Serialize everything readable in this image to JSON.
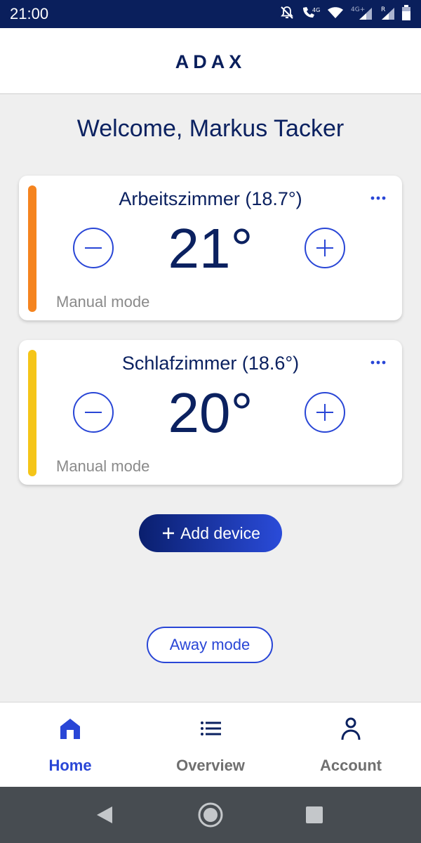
{
  "status_bar": {
    "time": "21:00",
    "signal_labels": [
      "4G",
      "4G+",
      "R"
    ]
  },
  "brand": {
    "logo_text": "ADAX",
    "color": "#0a1f5c",
    "accent": "#2946d6"
  },
  "welcome": "Welcome, Markus Tacker",
  "devices": [
    {
      "title": "Arbeitszimmer (18.7°)",
      "target": "21°",
      "mode": "Manual mode",
      "bar_color": "#f5841f"
    },
    {
      "title": "Schlafzimmer (18.6°)",
      "target": "20°",
      "mode": "Manual mode",
      "bar_color": "#f5c518"
    }
  ],
  "actions": {
    "add_device": "Add device",
    "away_mode": "Away mode"
  },
  "bottom_nav": [
    {
      "label": "Home",
      "icon": "home-icon",
      "active": true
    },
    {
      "label": "Overview",
      "icon": "list-icon",
      "active": false
    },
    {
      "label": "Account",
      "icon": "person-icon",
      "active": false
    }
  ],
  "colors": {
    "active_nav": "#2946d6",
    "inactive_nav": "#6f6f6f"
  }
}
